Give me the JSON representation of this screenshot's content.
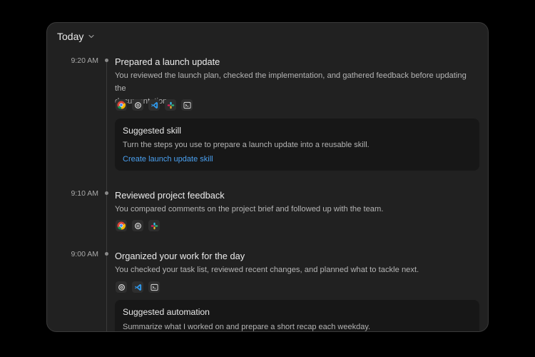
{
  "header": {
    "title": "Today"
  },
  "entries": [
    {
      "time": "9:20 AM",
      "title": "Prepared a launch update",
      "description_line1": "You reviewed the launch plan, checked the implementation, and gathered feedback before updating the",
      "description_line2": "documentation.",
      "apps": [
        "chrome-icon",
        "chatgpt-icon",
        "vscode-icon",
        "slack-icon",
        "terminal-icon"
      ],
      "card": {
        "title": "Suggested skill",
        "text": "Turn the steps you use to prepare a launch update into a reusable skill.",
        "link": "Create launch update skill"
      }
    },
    {
      "time": "9:10 AM",
      "title": "Reviewed project feedback",
      "description_line1": "You compared comments on the project brief and followed up with the team.",
      "apps": [
        "chrome-icon",
        "chatgpt-icon",
        "slack-icon"
      ]
    },
    {
      "time": "9:00 AM",
      "title": "Organized your work for the day",
      "description_line1": "You checked your task list, reviewed recent changes, and planned what to tackle next.",
      "apps": [
        "chatgpt-icon",
        "vscode-icon",
        "terminal-icon"
      ],
      "card": {
        "title": "Suggested automation",
        "text": "Summarize what I worked on and prepare a short recap each weekday."
      }
    }
  ],
  "colors": {
    "link": "#4aa0f0",
    "panel": "#212121",
    "card": "#171717"
  }
}
